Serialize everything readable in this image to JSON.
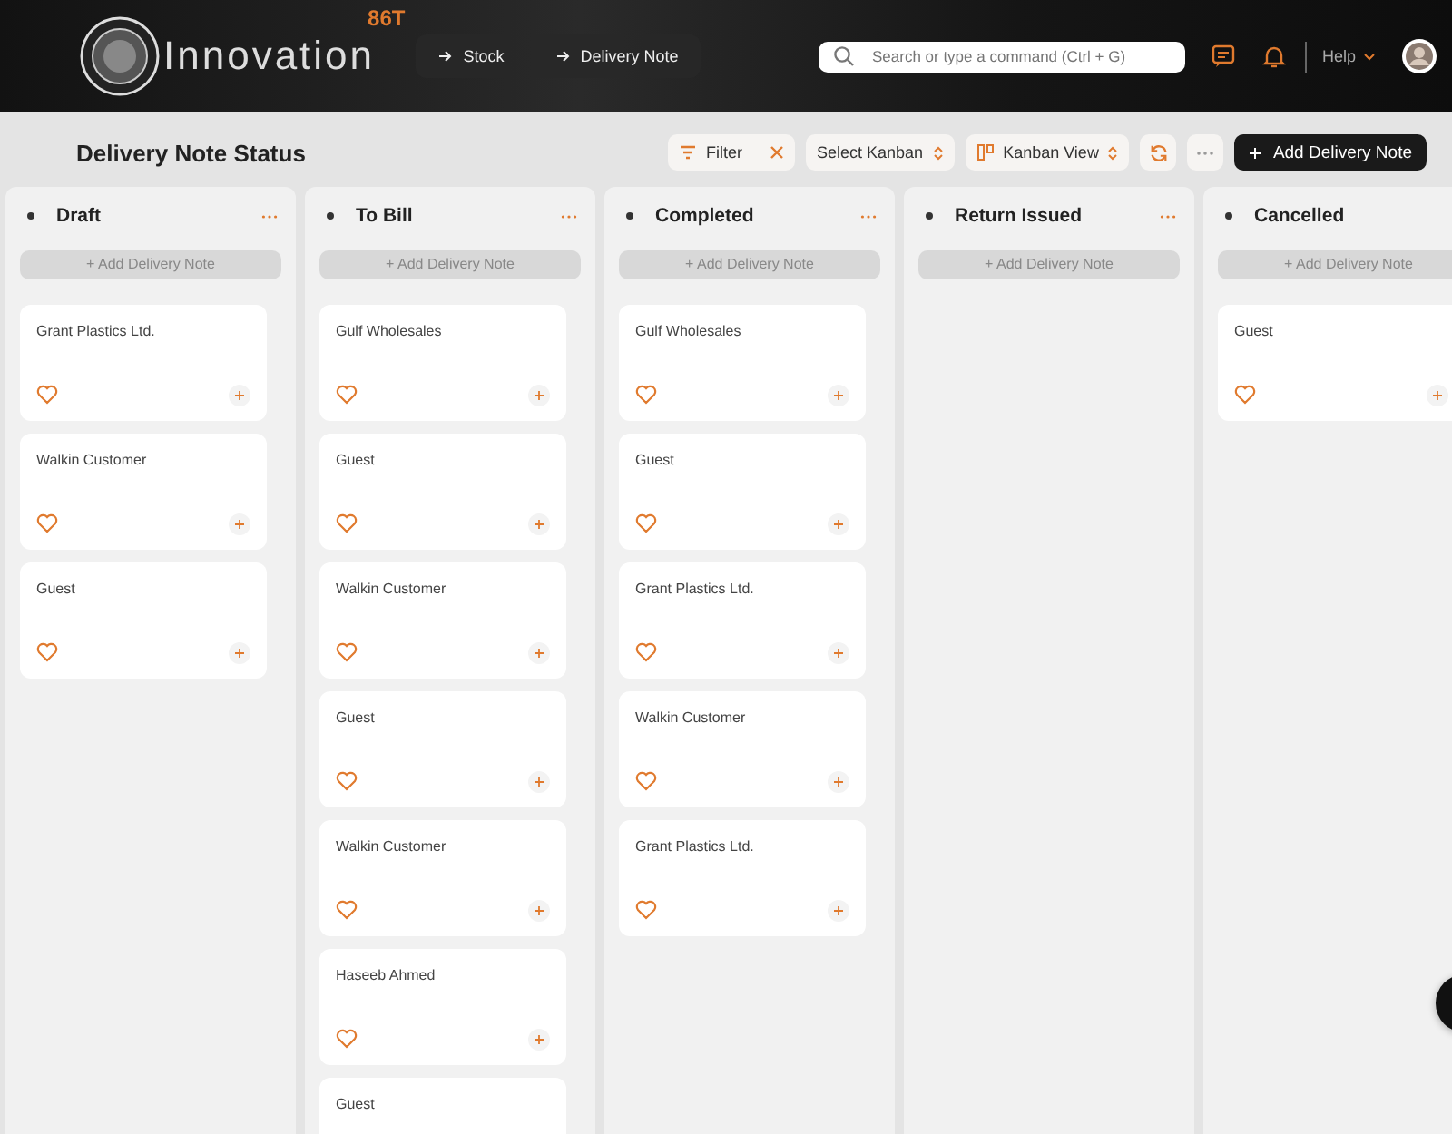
{
  "brand": {
    "name": "Innovation",
    "badge": "86T"
  },
  "breadcrumbs": [
    "Stock",
    "Delivery Note"
  ],
  "search": {
    "placeholder": "Search or type a command (Ctrl + G)"
  },
  "help": "Help",
  "page_title": "Delivery Note Status",
  "toolbar": {
    "filter": "Filter",
    "kanban_select": "Select Kanban",
    "view": "Kanban View",
    "primary": "Add Delivery Note"
  },
  "columns": [
    {
      "title": "Draft",
      "add": "+ Add Delivery Note",
      "cards": [
        "Grant Plastics Ltd.",
        "Walkin Customer",
        "Guest"
      ]
    },
    {
      "title": "To Bill",
      "add": "+ Add Delivery Note",
      "cards": [
        "Gulf Wholesales",
        "Guest",
        "Walkin Customer",
        "Guest",
        "Walkin Customer",
        "Haseeb Ahmed",
        "Guest"
      ]
    },
    {
      "title": "Completed",
      "add": "+ Add Delivery Note",
      "cards": [
        "Gulf Wholesales",
        "Guest",
        "Grant Plastics Ltd.",
        "Walkin Customer",
        "Grant Plastics Ltd."
      ]
    },
    {
      "title": "Return Issued",
      "add": "+ Add Delivery Note"
    },
    {
      "title": "Cancelled",
      "add": "+ Add Delivery Note",
      "cards": [
        "Guest"
      ]
    }
  ]
}
